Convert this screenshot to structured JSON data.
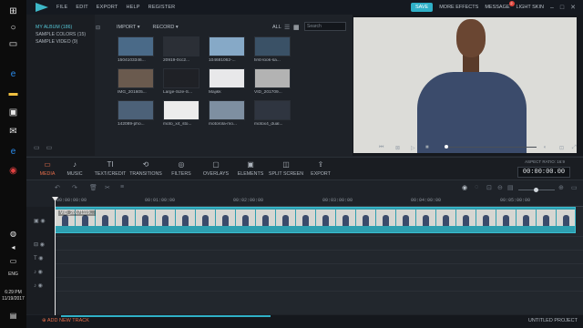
{
  "taskbar": {
    "time": "6:29 PM",
    "date": "11/19/2017",
    "lang": "ENG"
  },
  "menubar": {
    "items": [
      "FILE",
      "EDIT",
      "EXPORT",
      "HELP",
      "REGISTER"
    ],
    "save": "SAVE",
    "more_effects": "MORE EFFECTS",
    "message": "MESSAGE",
    "message_badge": "2",
    "light_skin": "LIGHT SKIN"
  },
  "library": {
    "items": [
      "MY ALBUM (186)",
      "SAMPLE COLORS (15)",
      "SAMPLE VIDEO (9)"
    ]
  },
  "media": {
    "import_label": "IMPORT",
    "record_label": "RECORD",
    "all_label": "ALL",
    "search_placeholder": "Search",
    "tiles": [
      {
        "label": "1504103346...",
        "color": "#4a6a88"
      },
      {
        "label": "20919-0cc2...",
        "color": "#2b2f36"
      },
      {
        "label": "104681062-...",
        "color": "#86a9c7"
      },
      {
        "label": "first-look-sa...",
        "color": "#3a5166"
      },
      {
        "label": "IMG_201605...",
        "color": "#6a5a4e"
      },
      {
        "label": "Large-Size-S...",
        "color": "#1f2126"
      },
      {
        "label": "Majikk",
        "color": "#e8e8ea"
      },
      {
        "label": "VID_201709...",
        "color": "#b3b3b3"
      },
      {
        "label": "142089-pho...",
        "color": "#4c6178"
      },
      {
        "label": "moto_x4_sto...",
        "color": "#ececec"
      },
      {
        "label": "motorola-mo...",
        "color": "#7e8fa1"
      },
      {
        "label": "motox4_dual...",
        "color": "#2f3540"
      }
    ]
  },
  "toolbar": {
    "tools": [
      "MEDIA",
      "MUSIC",
      "TEXT/CREDIT",
      "TRANSITIONS",
      "FILTERS",
      "OVERLAYS",
      "ELEMENTS",
      "SPLIT SCREEN",
      "EXPORT"
    ],
    "aspect_ratio": "ASPECT RATIO: 16:9",
    "timecode": "00:00:00.00"
  },
  "timeline": {
    "ruler": [
      "00:00:00:00",
      "00:01:00:00",
      "00:02:00:00",
      "00:03:00:00",
      "00:04:00:00",
      "00:05:00:00"
    ],
    "clip_name": "VID_20171119..."
  },
  "footer": {
    "add_track": "ADD NEW TRACK",
    "project": "UNTITLED PROJECT"
  }
}
